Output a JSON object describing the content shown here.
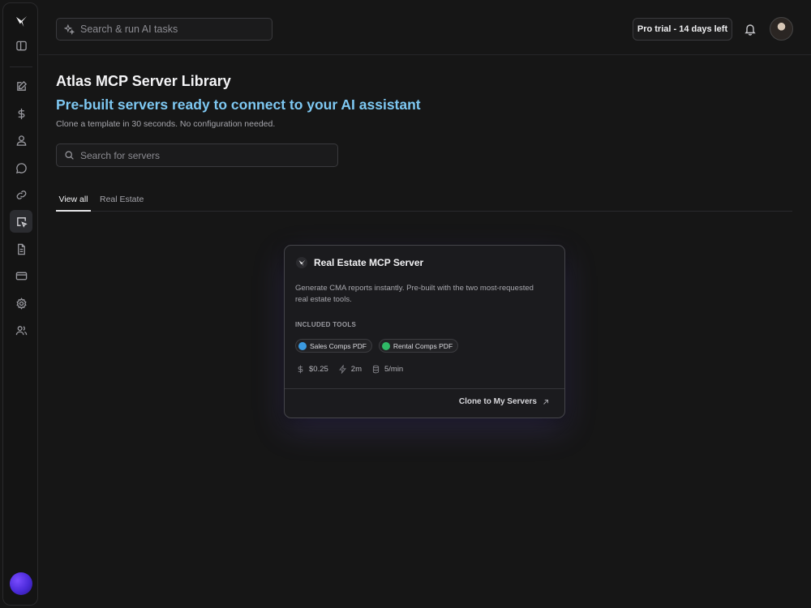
{
  "topbar": {
    "search_placeholder": "Search & run AI tasks",
    "trial_label": "Pro trial - 14 days left"
  },
  "sidebar": {
    "items": [
      {
        "icon": "panel-toggle-icon"
      },
      {
        "icon": "edit-icon"
      },
      {
        "icon": "dollar-icon"
      },
      {
        "icon": "user-icon"
      },
      {
        "icon": "chat-icon"
      },
      {
        "icon": "link-icon"
      },
      {
        "icon": "cursor-box-icon",
        "active": true
      },
      {
        "icon": "document-icon"
      },
      {
        "icon": "card-icon"
      },
      {
        "icon": "settings-icon"
      },
      {
        "icon": "users-icon"
      }
    ]
  },
  "main": {
    "title": "Atlas MCP Server Library",
    "subtitle": "Pre-built servers ready to connect to your AI assistant",
    "description": "Clone a template in 30 seconds. No configuration needed.",
    "search_placeholder": "Search for servers",
    "tabs": [
      {
        "label": "View all",
        "active": true
      },
      {
        "label": "Real Estate",
        "active": false
      }
    ]
  },
  "card": {
    "title": "Real Estate MCP Server",
    "description": "Generate CMA reports instantly. Pre-built with the two most-requested real estate tools.",
    "tools_label": "INCLUDED TOOLS",
    "tools": [
      {
        "label": "Sales Comps PDF",
        "color": "#3b9ae0"
      },
      {
        "label": "Rental Comps PDF",
        "color": "#2fb866"
      }
    ],
    "stats": {
      "price": "$0.25",
      "time": "2m",
      "rate": "5/min"
    },
    "clone_label": "Clone to My Servers"
  },
  "colors": {
    "accent_subtitle": "#7ec8f2",
    "background": "#161616"
  }
}
